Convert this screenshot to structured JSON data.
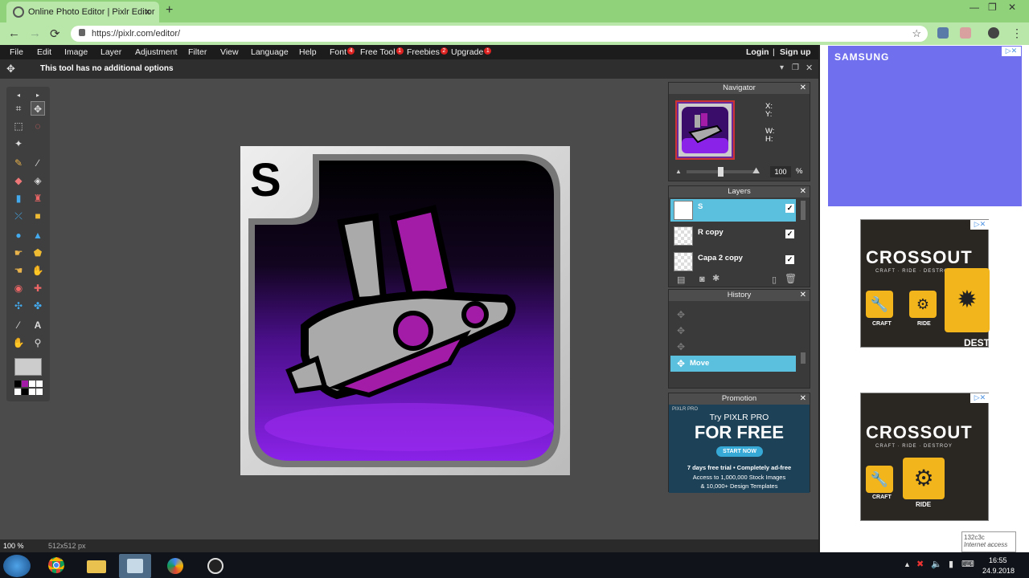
{
  "browser": {
    "tab_title": "Online Photo Editor | Pixlr Editor",
    "tab_close": "×",
    "new_tab": "+",
    "url": "https://pixlr.com/editor/",
    "back": "←",
    "forward": "→",
    "reload": "⟳",
    "star": "☆",
    "minimize": "—",
    "maximize": "❐",
    "close": "✕"
  },
  "menu": {
    "items": [
      {
        "label": "File"
      },
      {
        "label": "Edit"
      },
      {
        "label": "Image"
      },
      {
        "label": "Layer"
      },
      {
        "label": "Adjustment"
      },
      {
        "label": "Filter"
      },
      {
        "label": "View"
      },
      {
        "label": "Language"
      },
      {
        "label": "Help"
      },
      {
        "label": "Font",
        "badge": "4"
      },
      {
        "label": "Free Tool",
        "badge": "1"
      },
      {
        "label": "Freebies",
        "badge": "2"
      },
      {
        "label": "Upgrade",
        "badge": "1"
      }
    ],
    "login": "Login",
    "separator": "|",
    "signup": "Sign up"
  },
  "options_bar": {
    "message": "This tool has no additional options"
  },
  "navigator": {
    "title": "Navigator",
    "x_label": "X:",
    "y_label": "Y:",
    "w_label": "W:",
    "h_label": "H:",
    "zoom_value": "100",
    "zoom_unit": "%",
    "zoom_fraction": 0.5
  },
  "layers": {
    "title": "Layers",
    "items": [
      {
        "name": "S",
        "selected": true,
        "visible": "✓"
      },
      {
        "name": "R copy",
        "selected": false,
        "visible": "✓"
      },
      {
        "name": "Capa 2 copy",
        "selected": false,
        "visible": "✓"
      }
    ]
  },
  "history": {
    "title": "History",
    "items": [
      {
        "label": "Move",
        "selected": true
      }
    ]
  },
  "promotion": {
    "title": "Promotion",
    "brand": "PIXLR PRO",
    "line1": "Try PIXLR PRO",
    "line2": "FOR FREE",
    "cta": "START NOW",
    "detail1": "7 days free trial • Completely ad-free",
    "detail2": "Access to 1,000,000 Stock Images",
    "detail3": "& 10,000+ Design Templates"
  },
  "status": {
    "zoom": "100",
    "zoom_unit": "%",
    "size": "512x512 px"
  },
  "ads": {
    "samsung": "SAMSUNG",
    "crossout_title": "CROSSOUT",
    "crossout_sub": "CRAFT · RIDE · DESTROY",
    "craft": "CRAFT",
    "ride": "RIDE",
    "destroy_partial": "DESTI"
  },
  "network_tooltip": {
    "line1": "132c3c",
    "line2": "Internet access"
  },
  "clock": {
    "time": "16:55",
    "date": "24.9.2018"
  },
  "colors": {
    "selection": "#5bc0de",
    "menu_bg": "#1c1c1c",
    "panel_bg": "#3a3a3a",
    "purple": "#a21ca8",
    "badge_red": "#d22"
  }
}
